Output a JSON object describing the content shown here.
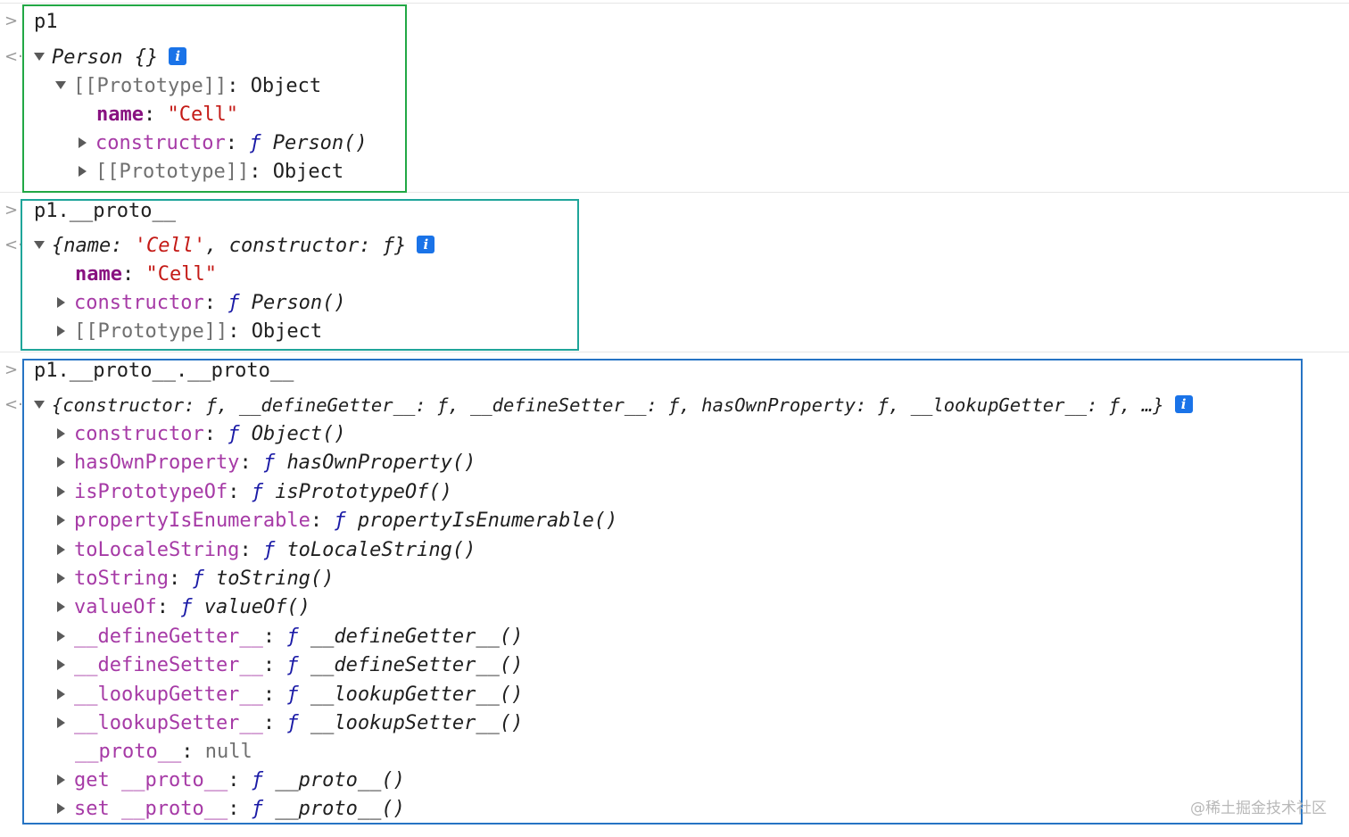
{
  "colors": {
    "box1": "#22a845",
    "box2": "#1fa59a",
    "box3": "#2674c4",
    "key": "#881280",
    "string": "#c41a16",
    "info": "#1a73e8"
  },
  "icons": {
    "input": "chevron-right-icon",
    "output": "return-arrow-icon",
    "expanded": "triangle-down-icon",
    "collapsed": "triangle-right-icon",
    "info": "info-icon"
  },
  "gutter": {
    "input": ">",
    "output": "<·"
  },
  "entry1": {
    "input": "p1",
    "summary_name": "Person",
    "summary_braces": "{}",
    "proto_key": "[[Prototype]]",
    "proto_sep": ": ",
    "proto_val": "Object",
    "name_key": "name",
    "name_sep": ": ",
    "name_val": "\"Cell\"",
    "ctor_key": "constructor",
    "ctor_sep": ": ",
    "ctor_f": "ƒ",
    "ctor_val": "Person()",
    "proto2_key": "[[Prototype]]",
    "proto2_sep": ": ",
    "proto2_val": "Object"
  },
  "entry2": {
    "input": "p1.__proto__",
    "sum_open": "{name: ",
    "sum_str": "'Cell'",
    "sum_close": ", constructor: ƒ}",
    "name_key": "name",
    "name_sep": ": ",
    "name_val": "\"Cell\"",
    "ctor_key": "constructor",
    "ctor_sep": ": ",
    "ctor_f": "ƒ",
    "ctor_val": "Person()",
    "proto_key": "[[Prototype]]",
    "proto_sep": ": ",
    "proto_val": "Object"
  },
  "entry3": {
    "input": "p1.__proto__.__proto__",
    "summary": "{constructor: ƒ, __defineGetter__: ƒ, __defineSetter__: ƒ, hasOwnProperty: ƒ, __lookupGetter__: ƒ, …}",
    "props": [
      {
        "key": "constructor",
        "sep": ": ",
        "f": "ƒ",
        "val": "Object()"
      },
      {
        "key": "hasOwnProperty",
        "sep": ": ",
        "f": "ƒ",
        "val": "hasOwnProperty()"
      },
      {
        "key": "isPrototypeOf",
        "sep": ": ",
        "f": "ƒ",
        "val": "isPrototypeOf()"
      },
      {
        "key": "propertyIsEnumerable",
        "sep": ": ",
        "f": "ƒ",
        "val": "propertyIsEnumerable()"
      },
      {
        "key": "toLocaleString",
        "sep": ": ",
        "f": "ƒ",
        "val": "toLocaleString()"
      },
      {
        "key": "toString",
        "sep": ": ",
        "f": "ƒ",
        "val": "toString()"
      },
      {
        "key": "valueOf",
        "sep": ": ",
        "f": "ƒ",
        "val": "valueOf()"
      },
      {
        "key": "__defineGetter__",
        "sep": ": ",
        "f": "ƒ",
        "val": "__defineGetter__()"
      },
      {
        "key": "__defineSetter__",
        "sep": ": ",
        "f": "ƒ",
        "val": "__defineSetter__()"
      },
      {
        "key": "__lookupGetter__",
        "sep": ": ",
        "f": "ƒ",
        "val": "__lookupGetter__()"
      },
      {
        "key": "__lookupSetter__",
        "sep": ": ",
        "f": "ƒ",
        "val": "__lookupSetter__()"
      }
    ],
    "proto_null_key": "__proto__",
    "proto_null_sep": ": ",
    "proto_null_val": "null",
    "get_key": "get __proto__",
    "get_sep": ": ",
    "get_f": "ƒ",
    "get_val": "__proto__()",
    "set_key": "set __proto__",
    "set_sep": ": ",
    "set_f": "ƒ",
    "set_val": "__proto__()"
  },
  "watermark": "@稀土掘金技术社区"
}
